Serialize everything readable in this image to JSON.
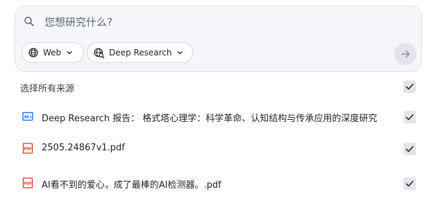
{
  "search": {
    "placeholder": "您想研究什么?"
  },
  "chips": {
    "web_label": "Web",
    "deep_research_label": "Deep Research"
  },
  "sources": {
    "select_all_label": "选择所有来源",
    "select_all_checked": true,
    "items": [
      {
        "title": "Deep Research 报告：  格式塔心理学：科学革命、认知结构与传承应用的深度研究",
        "icon": "deep-research-report-icon",
        "checked": true
      },
      {
        "title": "2505.24867v1.pdf",
        "icon": "pdf-icon",
        "checked": true
      },
      {
        "title": "AI看不到的爱心，成了最棒的AI检测器。.pdf",
        "icon": "pdf-icon",
        "checked": true
      }
    ]
  },
  "colors": {
    "card_background": "#f4f6fa",
    "checkbox_background": "#e2e4e8",
    "pdf_red": "#d93025",
    "report_blue": "#1a73e8",
    "send_button_background": "#e3e5ea"
  }
}
